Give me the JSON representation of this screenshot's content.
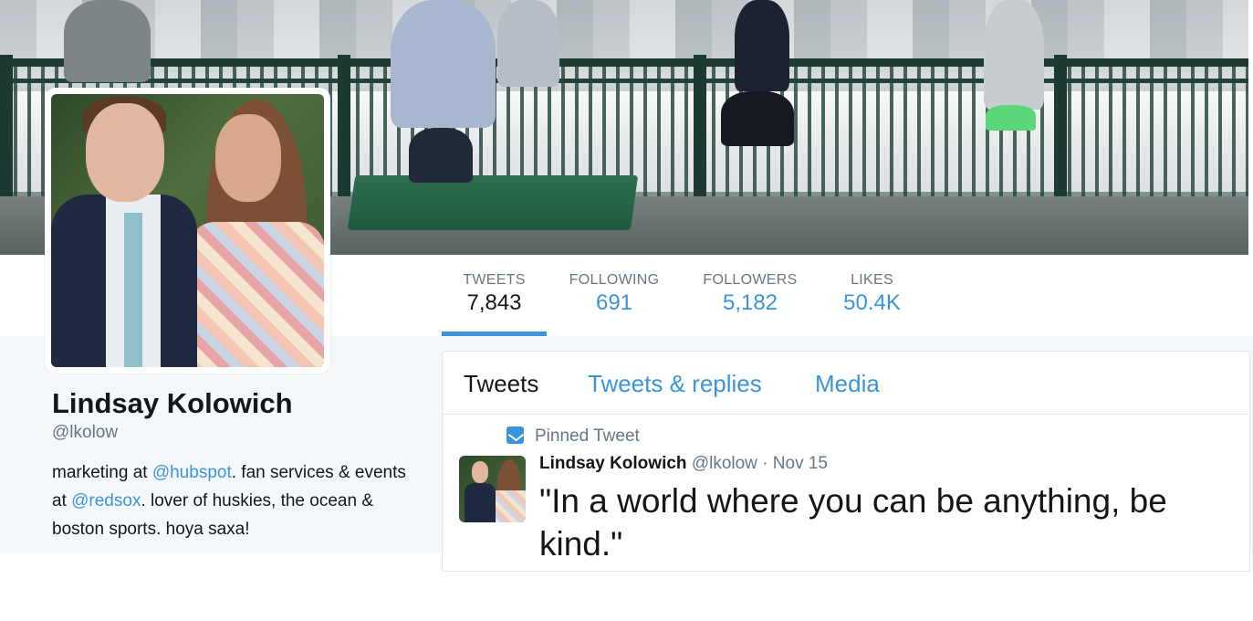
{
  "profile": {
    "name": "Lindsay Kolowich",
    "handle": "@lkolow",
    "bio": {
      "part1": "marketing at ",
      "link1": "@hubspot",
      "part2": ". fan services & events at ",
      "link2": "@redsox",
      "part3": ". lover of huskies, the ocean & boston sports. hoya saxa!"
    }
  },
  "stats": [
    {
      "label": "TWEETS",
      "value": "7,843",
      "active": true
    },
    {
      "label": "FOLLOWING",
      "value": "691",
      "active": false
    },
    {
      "label": "FOLLOWERS",
      "value": "5,182",
      "active": false
    },
    {
      "label": "LIKES",
      "value": "50.4K",
      "active": false
    }
  ],
  "timeline": {
    "tabs": [
      {
        "label": "Tweets",
        "active": true
      },
      {
        "label": "Tweets & replies",
        "active": false
      },
      {
        "label": "Media",
        "active": false
      }
    ],
    "pinned_label": "Pinned Tweet",
    "tweet": {
      "author_name": "Lindsay Kolowich",
      "author_handle": "@lkolow",
      "separator": "·",
      "date": "Nov 15",
      "text": "\"In a world where you can be anything, be kind.\""
    }
  },
  "colors": {
    "accent": "#3b94d9",
    "muted": "#657786",
    "text": "#14171a",
    "panel_bg": "#f5f8fa"
  },
  "icons": {
    "pinned": "pin-icon"
  }
}
